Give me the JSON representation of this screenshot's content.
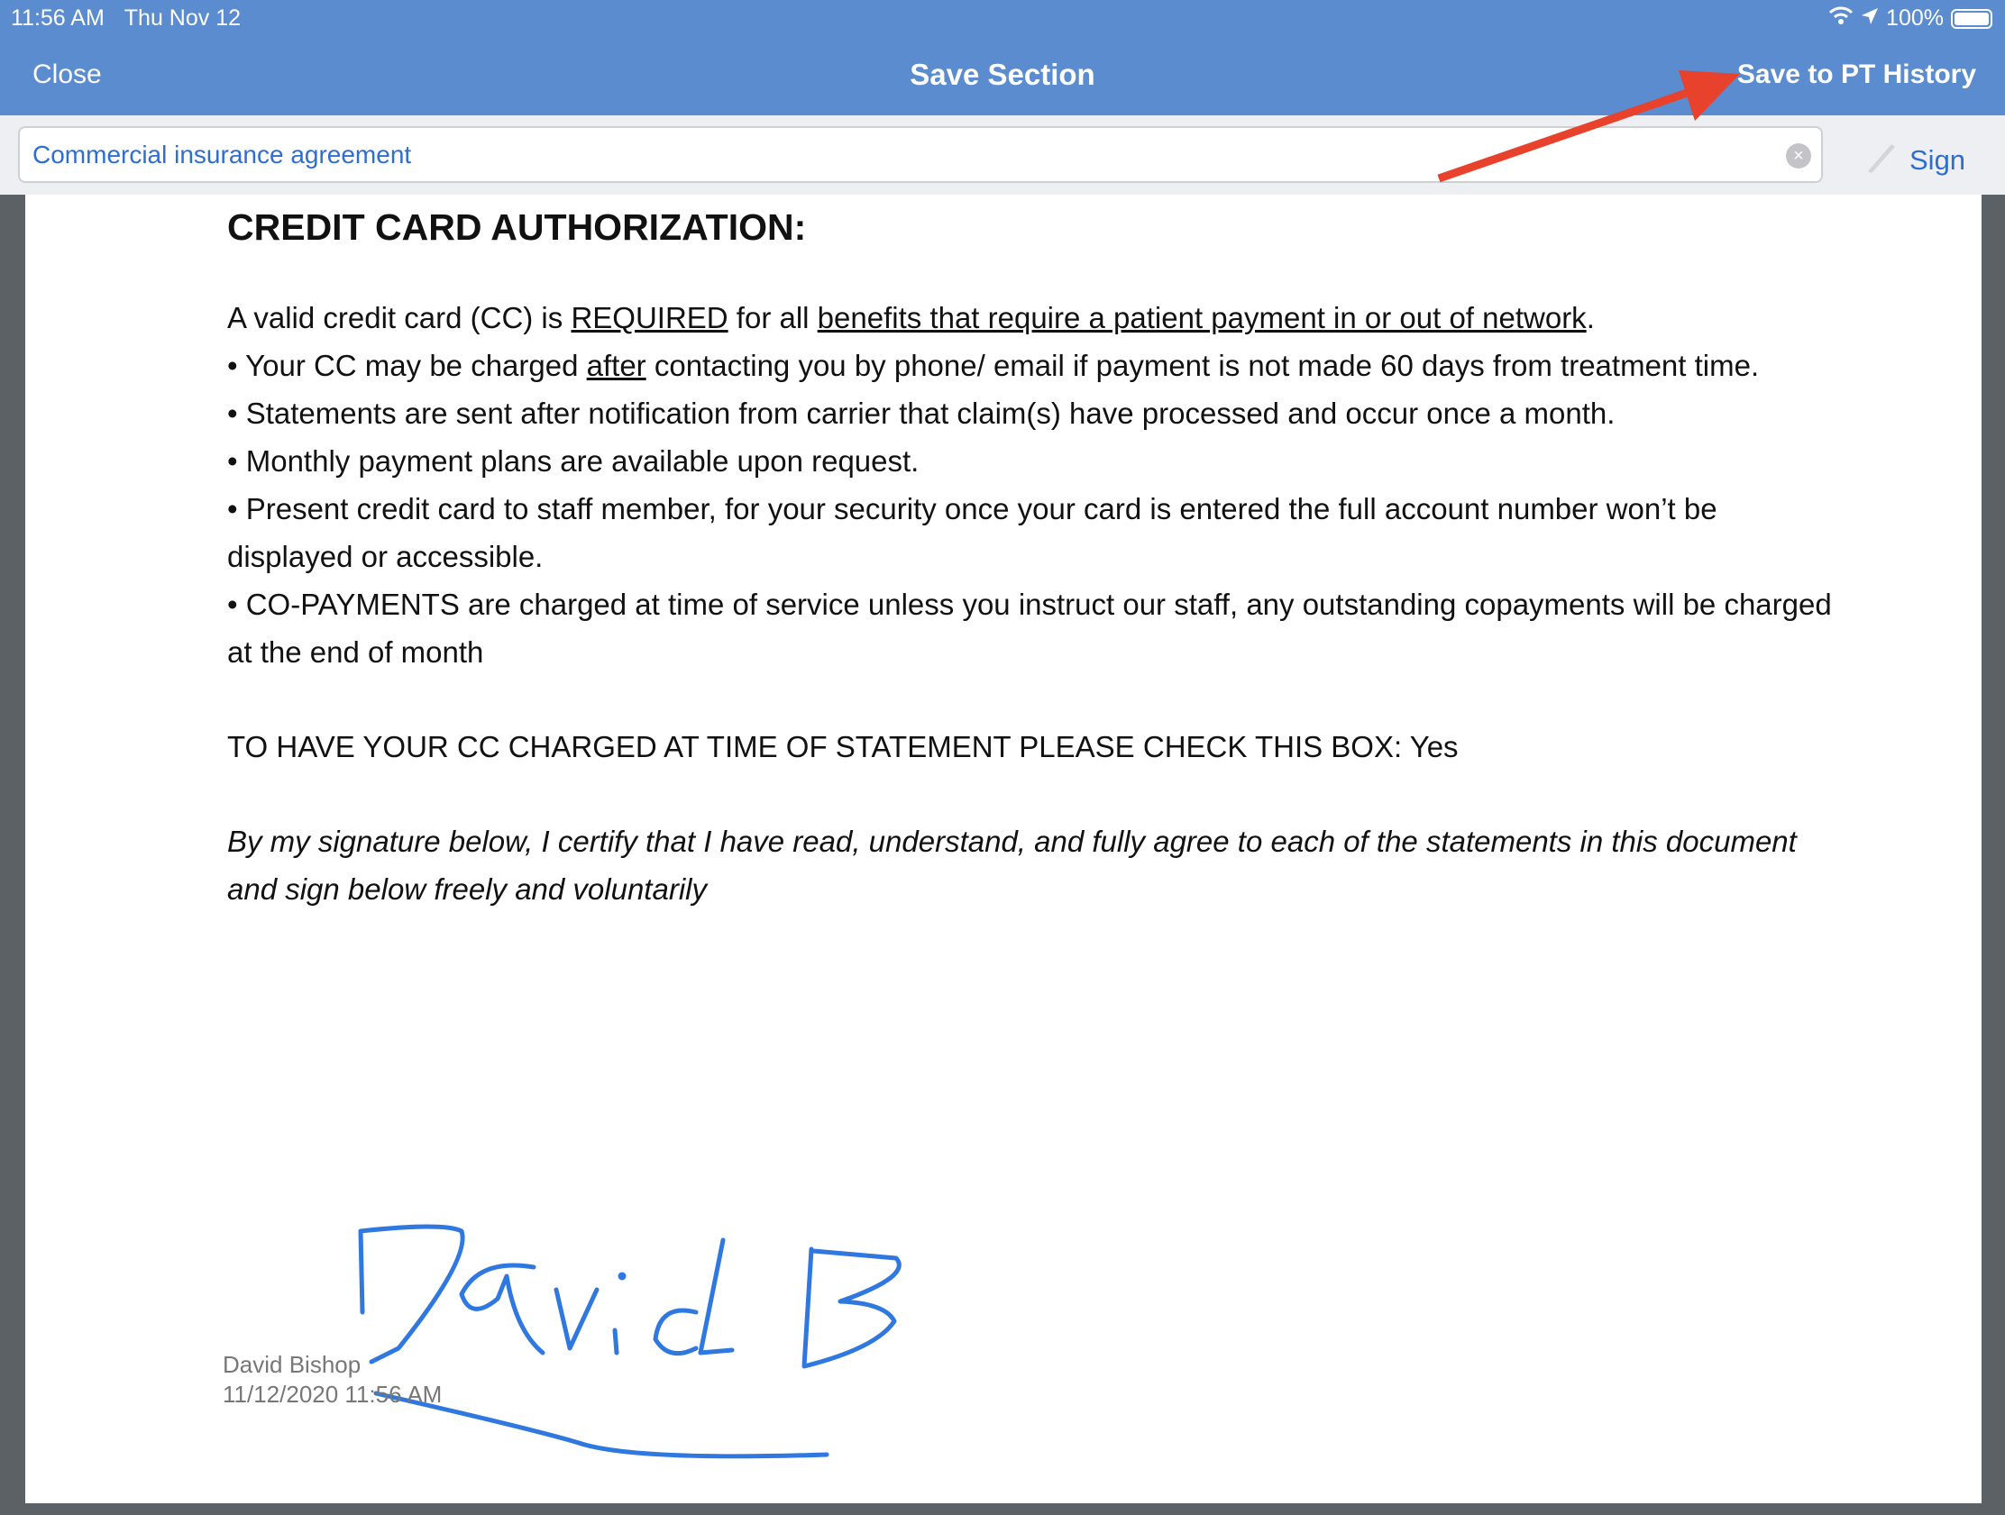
{
  "status_bar": {
    "time": "11:56 AM",
    "date": "Thu Nov 12",
    "battery": "100%"
  },
  "nav": {
    "close": "Close",
    "title": "Save Section",
    "save": "Save to PT History"
  },
  "toolbar": {
    "section_name": "Commercial insurance agreement",
    "sign": "Sign"
  },
  "document": {
    "heading": "CREDIT CARD AUTHORIZATION:",
    "intro": [
      "A valid credit card (CC) is ",
      "REQUIRED",
      " for all ",
      "benefits that require a patient payment in or out of network",
      "."
    ],
    "b1": [
      "• Your CC may be charged ",
      "after",
      " contacting you by phone/ email if payment is not made 60 days from treatment time."
    ],
    "b2": "• Statements are sent after notification from carrier that claim(s) have processed and occur once a month.",
    "b3": "• Monthly payment plans are available upon request.",
    "b4": "• Present credit card to staff member, for your security once your card is entered the full account number won’t be displayed or accessible.",
    "b5": "• CO-PAYMENTS are charged at time of service unless you instruct our staff, any outstanding copayments will be charged at the end of month",
    "checkbox_line": "TO HAVE YOUR CC CHARGED AT TIME OF STATEMENT PLEASE CHECK THIS BOX: Yes",
    "certify": "By my signature below, I certify that I have read, understand, and fully agree to each of the statements in this document and sign below freely and voluntarily",
    "signature_text": "David B",
    "signer_name": "David Bishop",
    "signed_at": "11/12/2020 11:56 AM"
  },
  "colors": {
    "header": "#5a8ccf",
    "link": "#2f6ed1",
    "signature": "#2f78e0",
    "annotation_arrow": "#e8412c"
  }
}
